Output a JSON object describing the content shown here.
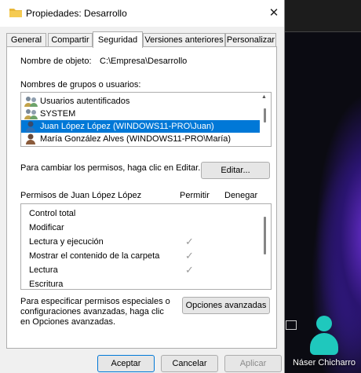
{
  "window": {
    "title": "Propiedades: Desarrollo"
  },
  "tabs": [
    "General",
    "Compartir",
    "Seguridad",
    "Versiones anteriores",
    "Personalizar"
  ],
  "active_tab": "Seguridad",
  "object": {
    "label": "Nombre de objeto:",
    "value": "C:\\Empresa\\Desarrollo"
  },
  "groups": {
    "label": "Nombres de grupos o usuarios:",
    "items": [
      {
        "name": "Usuarios autentificados",
        "icon": "users-group-icon"
      },
      {
        "name": "SYSTEM",
        "icon": "users-group-icon"
      },
      {
        "name": "Juan López López (WINDOWS11-PRO\\Juan)",
        "icon": "user-icon",
        "selected": true
      },
      {
        "name": "María González Alves (WINDOWS11-PRO\\María)",
        "icon": "user-icon"
      }
    ]
  },
  "edit_hint": "Para cambiar los permisos, haga clic en Editar.",
  "edit_button": "Editar...",
  "permissions": {
    "title": "Permisos de Juan López López",
    "allow_header": "Permitir",
    "deny_header": "Denegar",
    "rows": [
      {
        "name": "Control total",
        "allow": false,
        "deny": false
      },
      {
        "name": "Modificar",
        "allow": false,
        "deny": false
      },
      {
        "name": "Lectura y ejecución",
        "allow": true,
        "deny": false
      },
      {
        "name": "Mostrar el contenido de la carpeta",
        "allow": true,
        "deny": false
      },
      {
        "name": "Lectura",
        "allow": true,
        "deny": false
      },
      {
        "name": "Escritura",
        "allow": false,
        "deny": false
      }
    ]
  },
  "advanced": {
    "hint_lines": [
      "Para especificar permisos especiales o",
      "configuraciones avanzadas, haga clic",
      "en Opciones avanzadas."
    ],
    "button": "Opciones avanzadas"
  },
  "footer": {
    "ok": "Aceptar",
    "cancel": "Cancelar",
    "apply": "Aplicar"
  },
  "desktop": {
    "icon_label": "Náser Chicharro",
    "icon_color": "#1fc8bd"
  },
  "colors": {
    "selection": "#0078d7",
    "dialog_bg": "#f0f0f0"
  }
}
